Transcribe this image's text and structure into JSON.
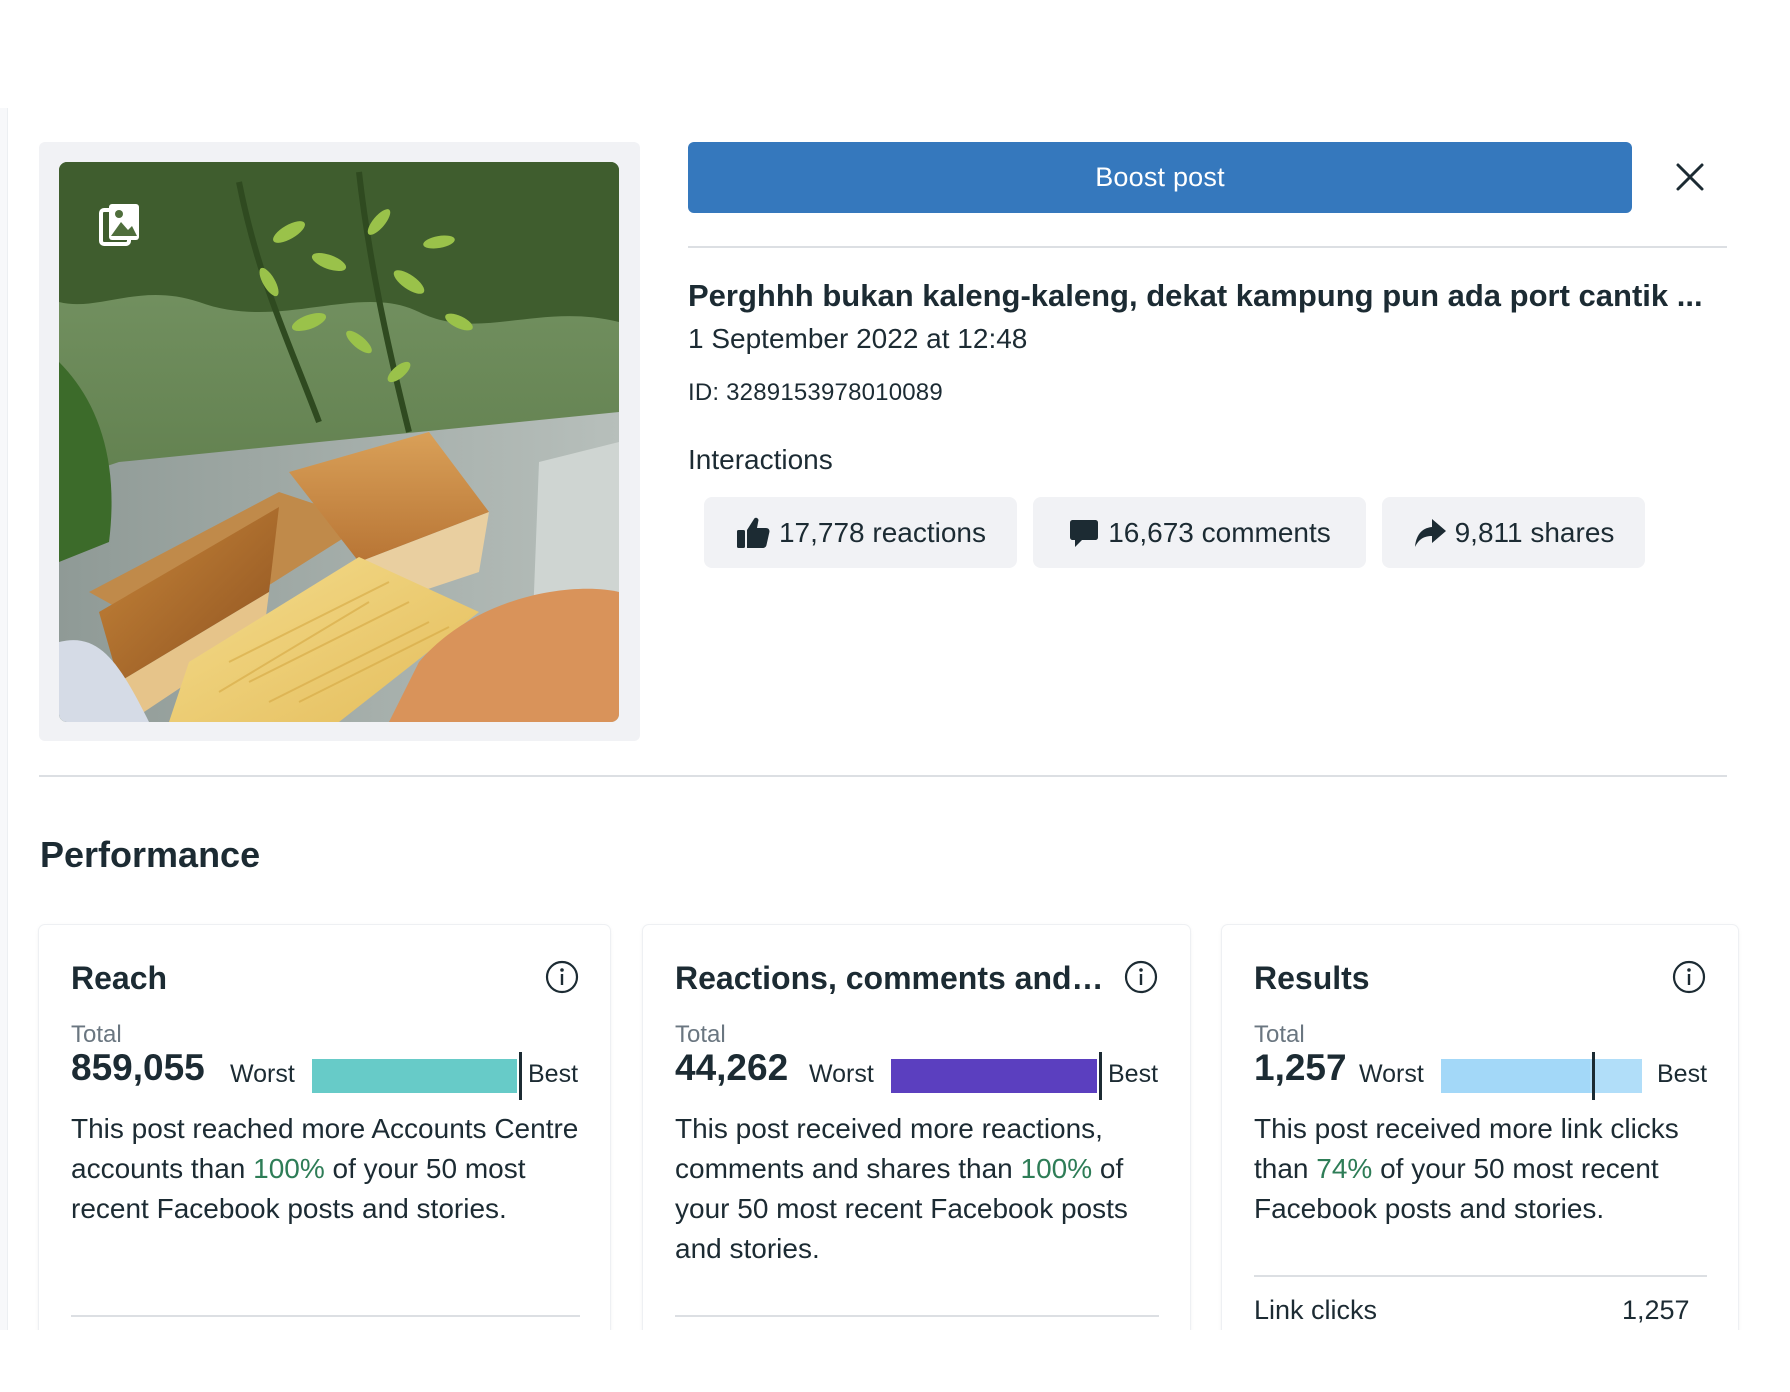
{
  "header": {
    "boost_label": "Boost post",
    "close_icon": "close-icon"
  },
  "post": {
    "title": "Perghhh bukan kaleng-kaleng, dekat kampung pun ada port cantik ...",
    "date": "1 September 2022 at 12:48",
    "id": "ID: 3289153978010089",
    "media_badge_icon": "photo-album-icon"
  },
  "interactions": {
    "label": "Interactions",
    "reactions": "17,778 reactions",
    "comments": "16,673 comments",
    "shares": "9,811 shares"
  },
  "performance": {
    "title": "Performance",
    "cards": [
      {
        "title": "Reach",
        "total_label": "Total",
        "total_value": "859,055",
        "worst_label": "Worst",
        "best_label": "Best",
        "percentile": 100,
        "bar_color": "#67cbc8",
        "desc_before": "This post reached more Accounts Centre accounts than ",
        "desc_pct": "100%",
        "desc_after": " of your 50 most recent Facebook posts and stories."
      },
      {
        "title": "Reactions, comments and shares",
        "total_label": "Total",
        "total_value": "44,262",
        "worst_label": "Worst",
        "best_label": "Best",
        "percentile": 100,
        "bar_color": "#5b3fbf",
        "desc_before": "This post received more reactions, comments and shares than ",
        "desc_pct": "100%",
        "desc_after": " of your 50 most recent Facebook posts and stories."
      },
      {
        "title": "Results",
        "total_label": "Total",
        "total_value": "1,257",
        "worst_label": "Worst",
        "best_label": "Best",
        "percentile": 74,
        "bar_color": "#a3d8f8",
        "desc_before": "This post received more link clicks than ",
        "desc_pct": "74%",
        "desc_after": " of your 50 most recent Facebook posts and stories.",
        "metric_label": "Link clicks",
        "metric_value": "1,257"
      }
    ]
  },
  "colors": {
    "accent": "#3578bd",
    "chip_bg": "#f1f2f5",
    "positive": "#2e7d57"
  }
}
